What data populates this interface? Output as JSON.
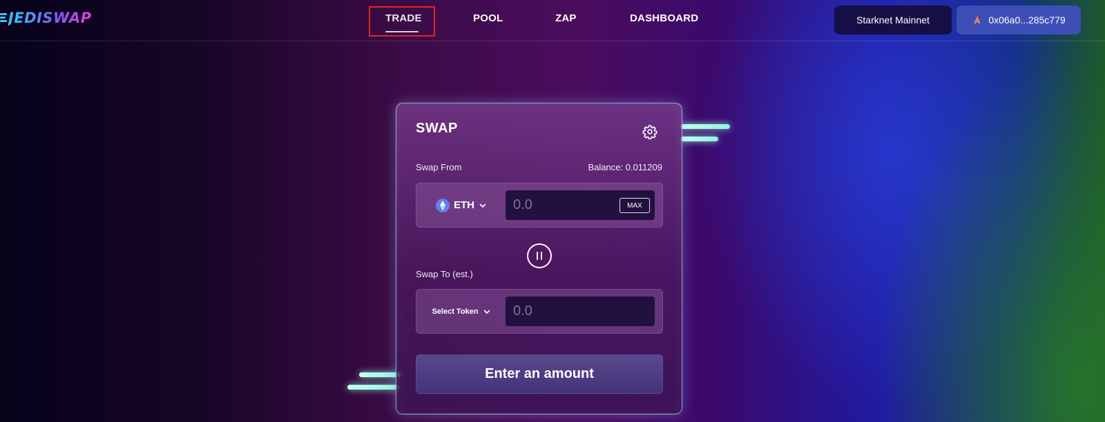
{
  "header": {
    "logo_text": "JEDISWAP",
    "nav": [
      {
        "label": "TRADE",
        "active": true
      },
      {
        "label": "POOL",
        "active": false
      },
      {
        "label": "ZAP",
        "active": false
      },
      {
        "label": "DASHBOARD",
        "active": false
      }
    ],
    "network_label": "Starknet Mainnet",
    "wallet_address": "0x06a0...285c779"
  },
  "swap": {
    "title": "SWAP",
    "from": {
      "label": "Swap From",
      "balance": "Balance: 0.011209",
      "token": "ETH",
      "amount_placeholder": "0.0",
      "max_label": "MAX"
    },
    "to": {
      "label": "Swap To (est.)",
      "token": "Select Token",
      "amount_placeholder": "0.0"
    },
    "submit_label": "Enter an amount"
  },
  "icons": {
    "settings": "gear-icon",
    "eth": "eth-icon",
    "swap_direction": "swap-direction-icon",
    "wallet": "argent-icon"
  },
  "colors": {
    "accent_blue": "#3d4fb6",
    "network_bg": "#150f45",
    "highlight": "#e3261d"
  }
}
